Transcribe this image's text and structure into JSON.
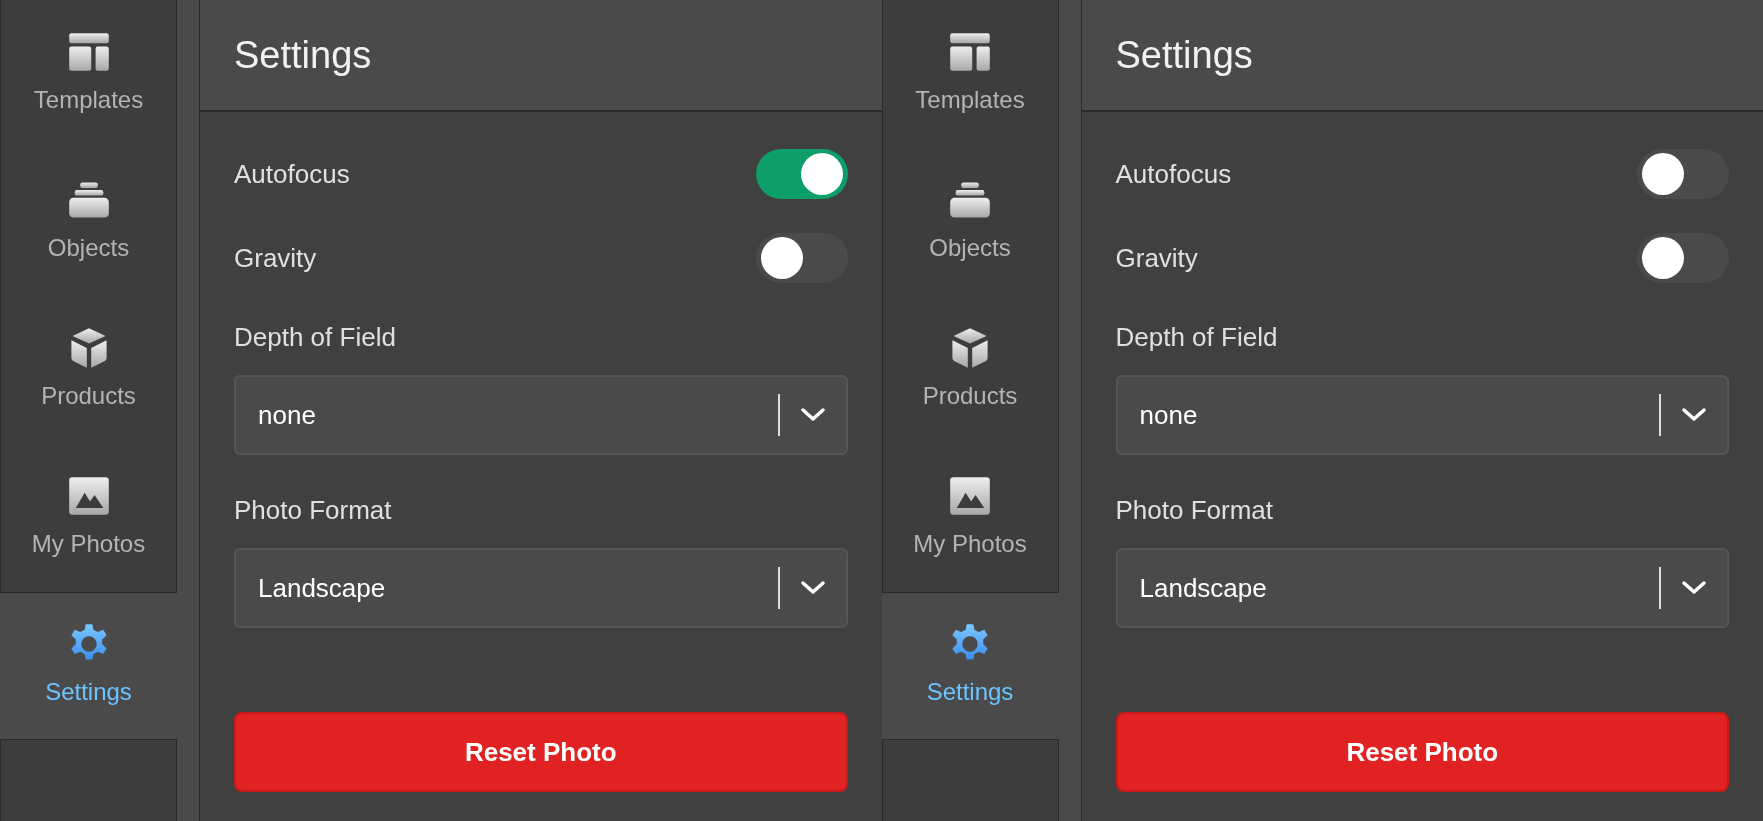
{
  "panels": [
    {
      "sidebar": {
        "items": [
          {
            "label": "Templates",
            "selected": false
          },
          {
            "label": "Objects",
            "selected": false
          },
          {
            "label": "Products",
            "selected": false
          },
          {
            "label": "My Photos",
            "selected": false
          },
          {
            "label": "Settings",
            "selected": true
          }
        ]
      },
      "title": "Settings",
      "fields": [
        {
          "kind": "toggle",
          "label": "Autofocus",
          "on": true
        },
        {
          "kind": "toggle",
          "label": "Gravity",
          "on": false
        },
        {
          "kind": "select",
          "label": "Depth of Field",
          "value": "none"
        },
        {
          "kind": "select",
          "label": "Photo Format",
          "value": "Landscape"
        }
      ],
      "button": "Reset Photo"
    },
    {
      "sidebar": {
        "items": [
          {
            "label": "Templates",
            "selected": false
          },
          {
            "label": "Objects",
            "selected": false
          },
          {
            "label": "Products",
            "selected": false
          },
          {
            "label": "My Photos",
            "selected": false
          },
          {
            "label": "Settings",
            "selected": true
          }
        ]
      },
      "title": "Settings",
      "fields": [
        {
          "kind": "toggle",
          "label": "Autofocus",
          "on": false
        },
        {
          "kind": "toggle",
          "label": "Gravity",
          "on": false
        },
        {
          "kind": "select",
          "label": "Depth of Field",
          "value": "none"
        },
        {
          "kind": "select",
          "label": "Photo Format",
          "value": "Landscape"
        }
      ],
      "button": "Reset Photo"
    }
  ]
}
